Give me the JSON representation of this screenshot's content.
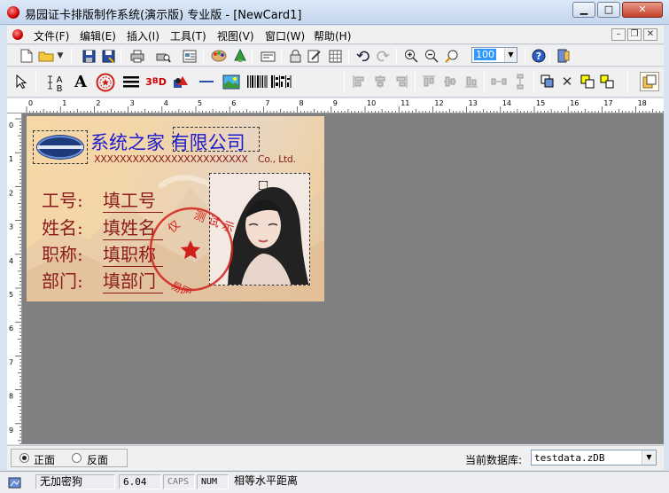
{
  "window": {
    "title": "易园证卡排版制作系统(演示版) 专业版 - [NewCard1]",
    "controls": [
      "minimize",
      "maximize",
      "close"
    ]
  },
  "menu": {
    "items": [
      "文件(F)",
      "编辑(E)",
      "插入(I)",
      "工具(T)",
      "视图(V)",
      "窗口(W)",
      "帮助(H)"
    ]
  },
  "toolbar": {
    "zoom_value": "100",
    "icons_row1": [
      "new-icon",
      "open-icon",
      "dropdown-icon",
      "save-icon",
      "save-as-icon",
      "print-icon",
      "print-preview-icon",
      "page-setup-icon",
      "palette-icon",
      "tree-icon",
      "card-icon",
      "lock-icon",
      "edit-icon",
      "grid-icon",
      "undo-icon",
      "redo-icon",
      "zoom-in-icon",
      "zoom-out-icon",
      "zoom-fit-icon",
      "help-icon",
      "exit-icon"
    ],
    "icons_row2": [
      "pointer-icon",
      "text-frame-icon",
      "text-icon",
      "seal-icon",
      "lines-icon",
      "code39-icon",
      "shapes-icon",
      "line-icon",
      "image-icon",
      "barcode-icon",
      "qrcode-icon",
      "align-left-icon",
      "align-center-icon",
      "align-right-icon",
      "align-top-icon",
      "align-middle-icon",
      "align-bottom-icon",
      "distribute-h-icon",
      "distribute-v-icon",
      "bring-front-icon",
      "delete-icon",
      "group-icon",
      "ungroup-icon",
      "note-icon"
    ]
  },
  "ruler": {
    "h_labels": [
      "0",
      "1",
      "2",
      "3",
      "4",
      "5",
      "6",
      "7",
      "8",
      "9",
      "10",
      "11",
      "12",
      "13",
      "14",
      "15",
      "16",
      "17",
      "18"
    ],
    "v_labels": [
      "0",
      "1",
      "2",
      "3",
      "4",
      "5",
      "6",
      "7",
      "8",
      "9"
    ]
  },
  "card": {
    "company_cn": "系统之家 有限公司",
    "company_en_x": "XXXXXXXXXXXXXXXXXXXXXXXX",
    "company_en_suffix": "Co., Ltd.",
    "fields": [
      {
        "label": "工号:",
        "value": "填工号"
      },
      {
        "label": "姓名:",
        "value": "填姓名"
      },
      {
        "label": "职称:",
        "value": "填职称"
      },
      {
        "label": "部门:",
        "value": "填部门"
      }
    ],
    "seal_text": "测试示例",
    "seal_fragments": [
      "仅",
      "易园"
    ]
  },
  "sidebar_bottom": {
    "front_label": "正面",
    "back_label": "反面",
    "db_label": "当前数据库:",
    "db_value": "testdata.zDB"
  },
  "status": {
    "password": "无加密狗",
    "version": "6.04",
    "caps": "CAPS",
    "num": "NUM",
    "hint": "相等水平距离"
  },
  "colors": {
    "card_text": "#8b1a1a",
    "company_text": "#1a1ad0",
    "canvas": "#808080",
    "seal": "#d0201a"
  }
}
